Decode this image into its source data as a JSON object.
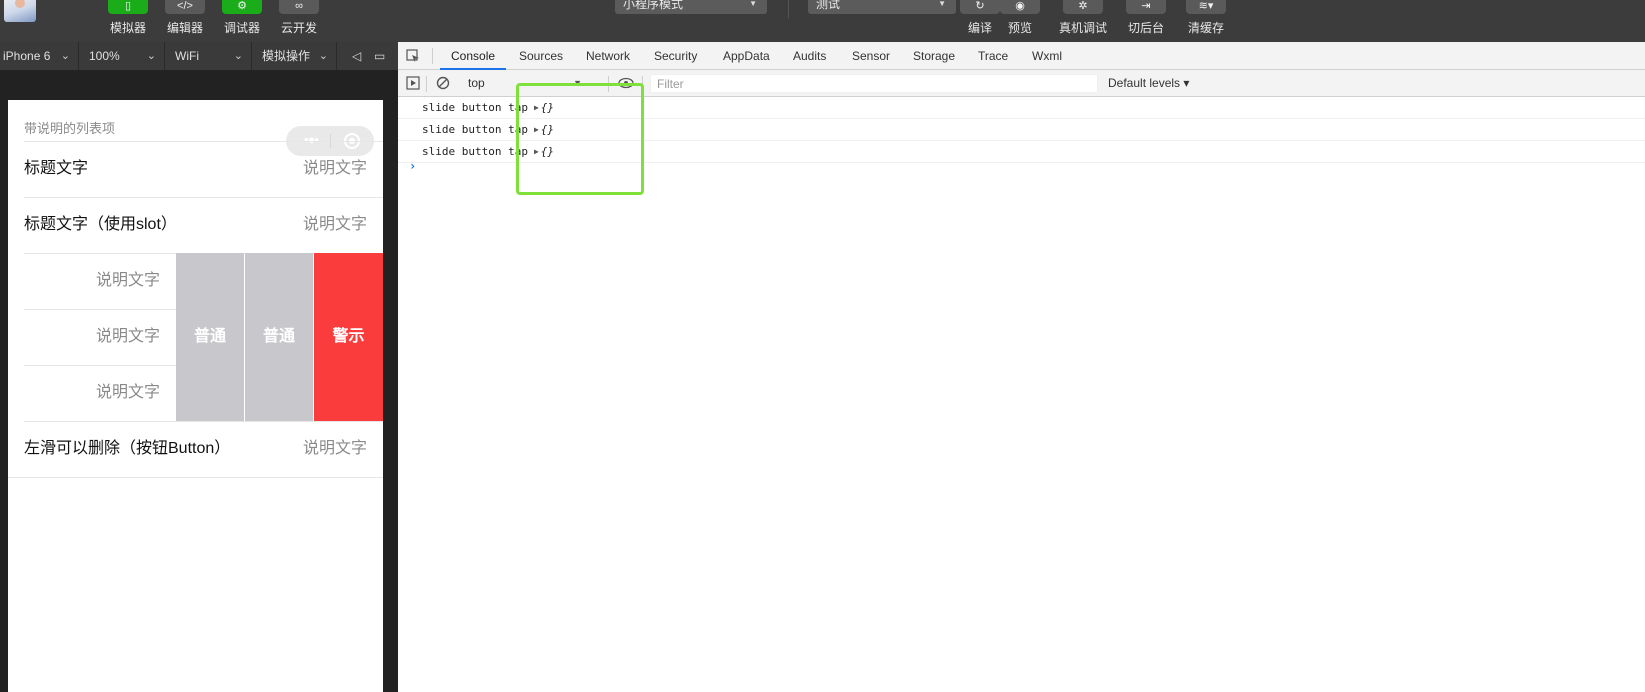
{
  "toolbar": {
    "tools_left": [
      {
        "label": "模拟器",
        "icon": "phone-icon"
      },
      {
        "label": "编辑器",
        "icon": "code-icon"
      },
      {
        "label": "调试器",
        "icon": "debug-icon"
      },
      {
        "label": "云开发",
        "icon": "cloud-icon"
      }
    ],
    "mode_select": "小程序模式",
    "compile_select": "测试",
    "tools_right": [
      {
        "label": "编译",
        "icon": "refresh-icon"
      },
      {
        "label": "预览",
        "icon": "eye-icon"
      },
      {
        "label": "真机调试",
        "icon": "bug-icon"
      },
      {
        "label": "切后台",
        "icon": "background-icon"
      },
      {
        "label": "清缓存",
        "icon": "layers-icon"
      }
    ]
  },
  "simulator": {
    "device": "iPhone 6",
    "zoom": "100%",
    "network": "WiFi",
    "operation": "模拟操作"
  },
  "page": {
    "section_label": "带说明的列表项",
    "cells": [
      {
        "title": "标题文字",
        "desc": "说明文字"
      },
      {
        "title": "标题文字（使用slot）",
        "desc": "说明文字"
      }
    ],
    "slide_cells": [
      {
        "desc": "说明文字"
      },
      {
        "desc": "说明文字"
      },
      {
        "desc": "说明文字"
      }
    ],
    "slide_buttons": [
      {
        "label": "普通",
        "type": "default"
      },
      {
        "label": "普通",
        "type": "default"
      },
      {
        "label": "警示",
        "type": "warn"
      }
    ],
    "last_cell": {
      "title": "左滑可以删除（按钮Button）",
      "desc": "说明文字"
    }
  },
  "devtools": {
    "tabs": [
      {
        "label": "Console",
        "active": true
      },
      {
        "label": "Sources"
      },
      {
        "label": "Network"
      },
      {
        "label": "Security"
      },
      {
        "label": "AppData"
      },
      {
        "label": "Audits"
      },
      {
        "label": "Sensor"
      },
      {
        "label": "Storage"
      },
      {
        "label": "Trace"
      },
      {
        "label": "Wxml"
      }
    ],
    "context": "top",
    "filter_placeholder": "Filter",
    "levels": "Default levels ▾",
    "logs": [
      {
        "text": "slide button tap",
        "object": "{}"
      },
      {
        "text": "slide button tap",
        "object": "{}"
      },
      {
        "text": "slide button tap",
        "object": "{}"
      }
    ],
    "prompt": "›"
  },
  "colors": {
    "toolbar_bg": "#3c3c3c",
    "accent_green": "#1aad19",
    "warn_red": "#fa3c3c",
    "default_button_gray": "#c7c7cc",
    "devtools_blue": "#1a73e8",
    "highlight_green": "#7ee03a"
  }
}
